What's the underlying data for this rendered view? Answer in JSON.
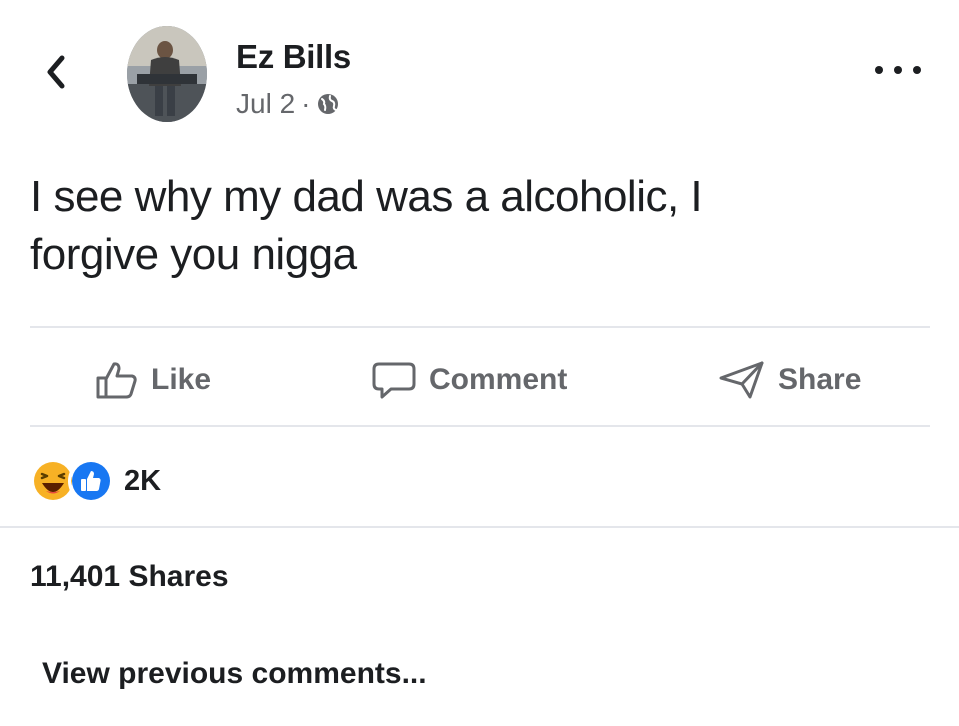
{
  "post": {
    "author_name": "Ez Bills",
    "date": "Jul 2",
    "separator": "·",
    "audience_icon": "globe-icon",
    "text_line_1": "I see why my dad was a alcoholic, I",
    "text_line_2": "forgive you nigga"
  },
  "header": {
    "back_icon": "chevron-left-icon",
    "more_icon": "more-options-icon"
  },
  "actions": {
    "like_label": "Like",
    "comment_label": "Comment",
    "share_label": "Share"
  },
  "reactions": {
    "types": [
      "haha",
      "like"
    ],
    "count": "2K"
  },
  "shares": {
    "label": "11,401 Shares"
  },
  "comments": {
    "view_previous_label": "View previous comments..."
  },
  "colors": {
    "text_primary": "#1c1e21",
    "text_secondary": "#65676b",
    "divider": "#e4e6eb",
    "like_blue": "#1877f2",
    "haha_yellow": "#f7b125"
  }
}
